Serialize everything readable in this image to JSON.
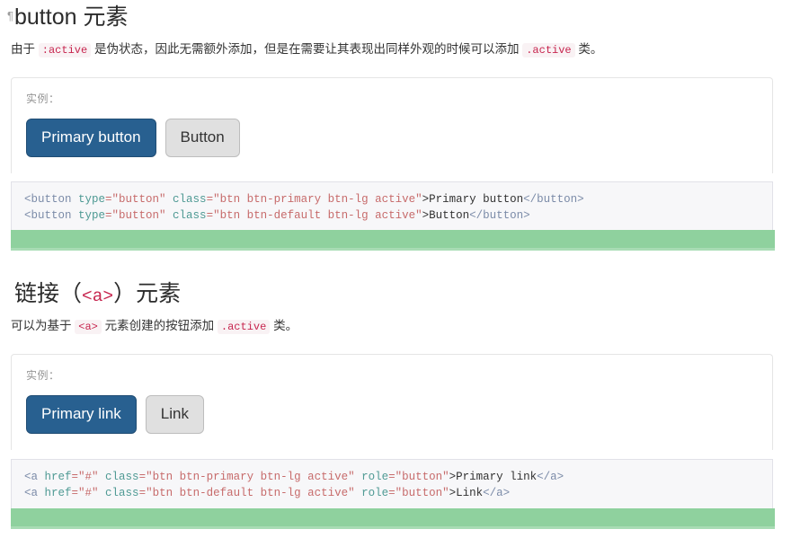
{
  "sections": [
    {
      "anchor_glyph": "¶",
      "heading_prefix": "",
      "heading_text": "button 元素",
      "heading_code": "",
      "heading_suffix": "",
      "lead": {
        "part1": "由于",
        "code1": ":active",
        "part2": "是伪状态，因此无需额外添加，但是在需要让其表现出同样外观的时候可以添加",
        "code2": ".active",
        "part3": "类。"
      },
      "example": {
        "label": "实例：",
        "primary_button_label": "Primary button",
        "default_button_label": "Button"
      },
      "code_lines": [
        [
          {
            "t": "<button",
            "c": "nt"
          },
          {
            "t": " type",
            "c": "na"
          },
          {
            "t": "=\"button\"",
            "c": "s"
          },
          {
            "t": " class",
            "c": "na"
          },
          {
            "t": "=\"btn btn-primary btn-lg active\"",
            "c": "s"
          },
          {
            "t": ">Primary button",
            "c": "txt"
          },
          {
            "t": "</button>",
            "c": "nt"
          }
        ],
        [
          {
            "t": "<button",
            "c": "nt"
          },
          {
            "t": " type",
            "c": "na"
          },
          {
            "t": "=\"button\"",
            "c": "s"
          },
          {
            "t": " class",
            "c": "na"
          },
          {
            "t": "=\"btn btn-default btn-lg active\"",
            "c": "s"
          },
          {
            "t": ">Button",
            "c": "txt"
          },
          {
            "t": "</button>",
            "c": "nt"
          }
        ]
      ]
    },
    {
      "anchor_glyph": "",
      "heading_prefix": "链接（",
      "heading_text": "",
      "heading_code": "<a>",
      "heading_suffix": "）元素",
      "lead": {
        "part1": "可以为基于",
        "code1": "<a>",
        "part2": "元素创建的按钮添加",
        "code2": ".active",
        "part3": "类。"
      },
      "example": {
        "label": "实例：",
        "primary_button_label": "Primary link",
        "default_button_label": "Link"
      },
      "code_lines": [
        [
          {
            "t": "<a",
            "c": "nt"
          },
          {
            "t": " href",
            "c": "na"
          },
          {
            "t": "=\"#\"",
            "c": "s"
          },
          {
            "t": " class",
            "c": "na"
          },
          {
            "t": "=\"btn btn-primary btn-lg active\"",
            "c": "s"
          },
          {
            "t": " role",
            "c": "na"
          },
          {
            "t": "=\"button\"",
            "c": "s"
          },
          {
            "t": ">Primary link",
            "c": "txt"
          },
          {
            "t": "</a>",
            "c": "nt"
          }
        ],
        [
          {
            "t": "<a",
            "c": "nt"
          },
          {
            "t": " href",
            "c": "na"
          },
          {
            "t": "=\"#\"",
            "c": "s"
          },
          {
            "t": " class",
            "c": "na"
          },
          {
            "t": "=\"btn btn-default btn-lg active\"",
            "c": "s"
          },
          {
            "t": " role",
            "c": "na"
          },
          {
            "t": "=\"button\"",
            "c": "s"
          },
          {
            "t": ">Link",
            "c": "txt"
          },
          {
            "t": "</a>",
            "c": "nt"
          }
        ]
      ]
    }
  ],
  "colors": {
    "primary_button_bg": "#286090",
    "primary_button_border": "#204d74",
    "default_button_bg": "#e0e0e0",
    "default_button_border": "#bdbdbd",
    "inline_code_text": "#c7254e",
    "inline_code_bg": "#f9f2f4",
    "code_block_bg": "#f7f7f9",
    "code_block_border": "#e1e1e8",
    "green_bar": "#8fd19e",
    "green_bar_underline": "#a8dcb4",
    "panel_border": "#e5e5e5"
  }
}
